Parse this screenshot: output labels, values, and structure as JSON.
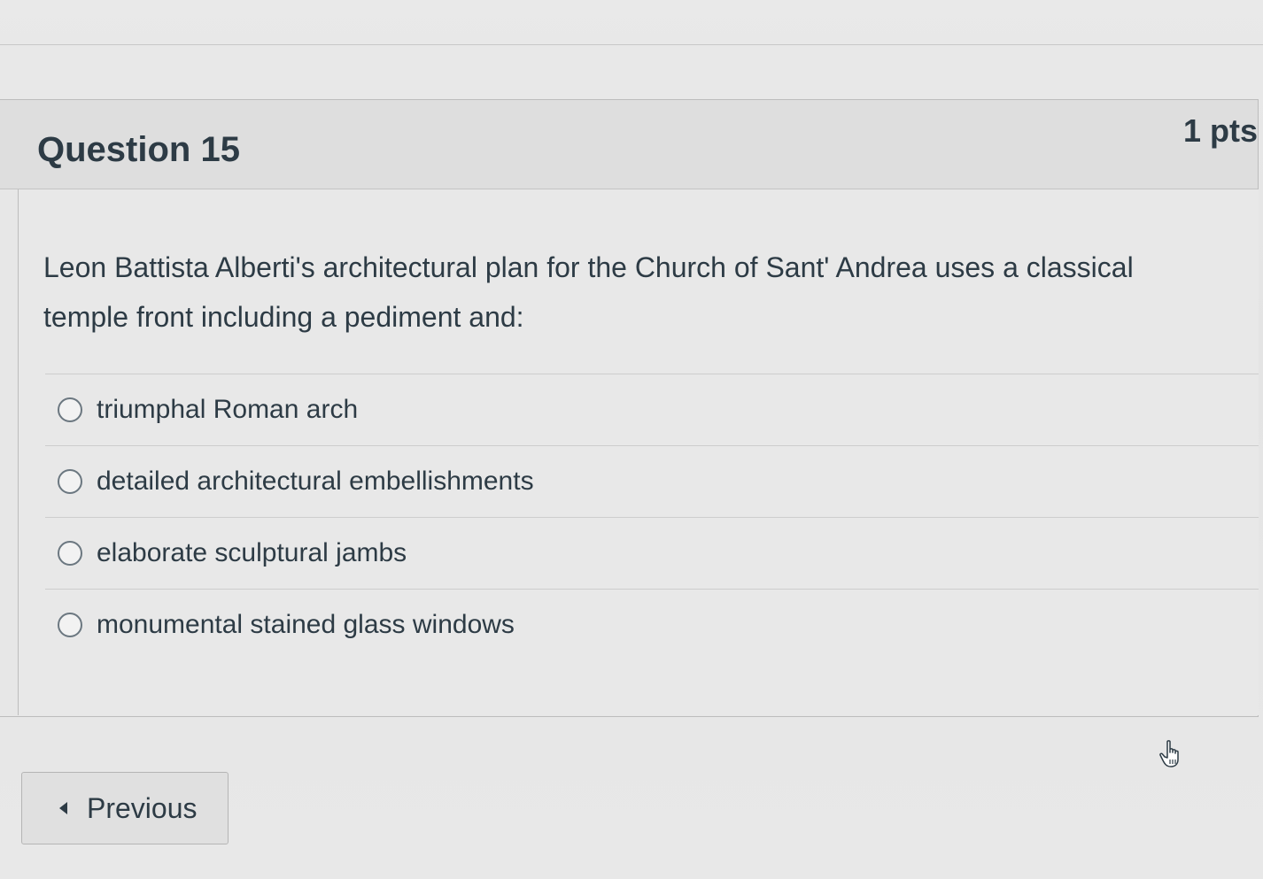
{
  "question": {
    "title": "Question 15",
    "points": "1 pts",
    "text": "Leon Battista Alberti's architectural plan for the Church of Sant' Andrea uses a classical temple front including a pediment and:",
    "answers": [
      {
        "label": "triumphal Roman arch"
      },
      {
        "label": "detailed architectural embellishments"
      },
      {
        "label": "elaborate sculptural jambs"
      },
      {
        "label": "monumental stained glass windows"
      }
    ]
  },
  "navigation": {
    "previous_label": "Previous",
    "previous_icon": "caret-left-icon"
  },
  "pointer": {
    "icon": "hand-pointer-icon"
  }
}
